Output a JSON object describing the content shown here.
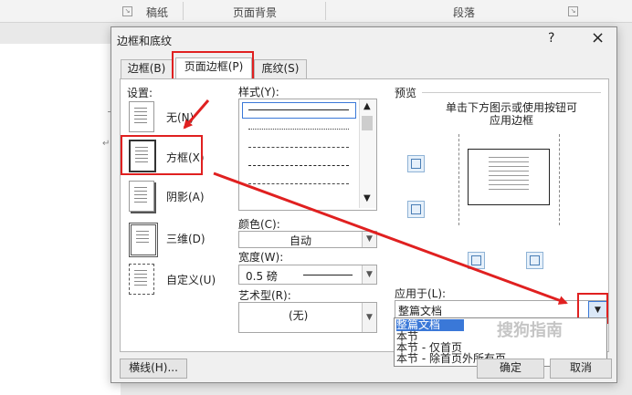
{
  "ribbon": {
    "group1": "稿纸",
    "group2": "页面背景",
    "group3": "段落"
  },
  "dialog": {
    "title": "边框和底纹",
    "help": "?",
    "close": "×",
    "tabs": [
      {
        "label": "边框(B)",
        "selected": false
      },
      {
        "label": "页面边框(P)",
        "selected": true
      },
      {
        "label": "底纹(S)",
        "selected": false
      }
    ],
    "settings": {
      "label": "设置:",
      "items": [
        {
          "label": "无(N)"
        },
        {
          "label": "方框(X)"
        },
        {
          "label": "阴影(A)"
        },
        {
          "label": "三维(D)"
        },
        {
          "label": "自定义(U)"
        }
      ]
    },
    "style": {
      "label": "样式(Y):"
    },
    "color": {
      "label": "颜色(C):",
      "value": "自动"
    },
    "width": {
      "label": "宽度(W):",
      "value": "0.5 磅"
    },
    "art": {
      "label": "艺术型(R):",
      "value": "(无)"
    },
    "preview": {
      "label": "预览",
      "hint_line1": "单击下方图示或使用按钮可",
      "hint_line2": "应用边框"
    },
    "apply_to": {
      "label": "应用于(L):",
      "value": "整篇文档",
      "options": [
        "整篇文档",
        "本节",
        "本节 - 仅首页",
        "本节 - 除首页外所有页"
      ],
      "selected_index": 0
    },
    "buttons": {
      "horizontal_line": "横线(H)...",
      "ok": "确定",
      "cancel": "取消"
    }
  },
  "watermark": "搜狗指南",
  "colors": {
    "annotation_red": "#e02020",
    "selection_blue": "#3a78d8"
  }
}
